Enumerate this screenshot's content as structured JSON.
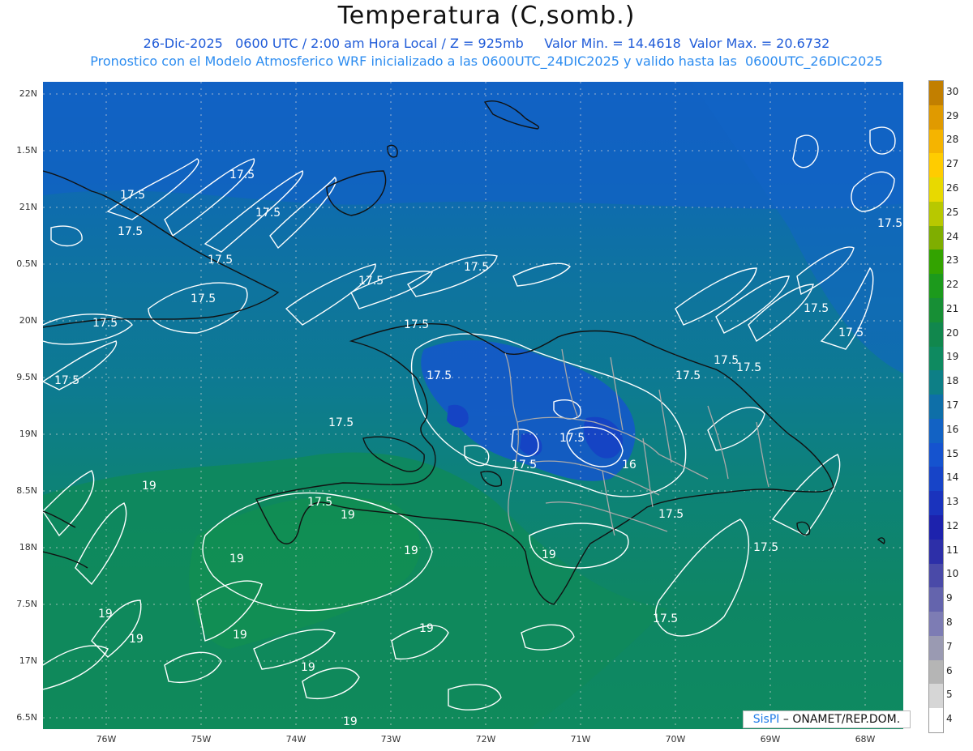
{
  "header": {
    "title": "Temperatura (C,somb.)",
    "line1": "26-Dic-2025   0600 UTC / 2:00 am Hora Local / Z = 925mb     Valor Min. = 14.4618  Valor Max. = 20.6732",
    "line2": "Pronostico con el Modelo Atmosferico WRF inicializado a las 0600UTC_24DIC2025 y valido hasta las  0600UTC_26DIC2025"
  },
  "axes": {
    "x_ticks": [
      "76W",
      "75W",
      "74W",
      "73W",
      "72W",
      "71W",
      "70W",
      "69W",
      "68W"
    ],
    "y_ticks": [
      "22N",
      "1.5N",
      "21N",
      "0.5N",
      "20N",
      "9.5N",
      "19N",
      "8.5N",
      "18N",
      "7.5N",
      "17N",
      "6.5N"
    ]
  },
  "legend": {
    "labels": [
      "30",
      "29",
      "28",
      "27",
      "26",
      "25",
      "24",
      "23",
      "22",
      "21",
      "20",
      "19",
      "18",
      "17",
      "16",
      "15",
      "14",
      "13",
      "12",
      "11",
      "10",
      "9",
      "8",
      "7",
      "6",
      "5",
      "4"
    ],
    "colors": [
      "#c27f00",
      "#e09a00",
      "#f5b400",
      "#ffcc00",
      "#e8d900",
      "#b8c800",
      "#7fae00",
      "#33a300",
      "#1c9a1c",
      "#178f35",
      "#11874d",
      "#0e8a60",
      "#0d7f86",
      "#0e6fa8",
      "#1262c4",
      "#1553cf",
      "#1744c8",
      "#1a33bd",
      "#1d22ad",
      "#2d2fa8",
      "#4a4aa8",
      "#6464ad",
      "#7d7cb4",
      "#9a9ab2",
      "#b5b5b5",
      "#d6d6d6",
      "#ffffff"
    ]
  },
  "contour_labels": [
    {
      "text": "17.5"
    },
    {
      "text": "17.5"
    },
    {
      "text": "17.5"
    },
    {
      "text": "17.5"
    },
    {
      "text": "17.5"
    },
    {
      "text": "17.5"
    },
    {
      "text": "17.5"
    },
    {
      "text": "17.5"
    },
    {
      "text": "17.5"
    },
    {
      "text": "17.5"
    },
    {
      "text": "17.5"
    },
    {
      "text": "17.5"
    },
    {
      "text": "17.5"
    },
    {
      "text": "17.5"
    },
    {
      "text": "17.5"
    },
    {
      "text": "17.5"
    },
    {
      "text": "17.5"
    },
    {
      "text": "16"
    },
    {
      "text": "17.5"
    },
    {
      "text": "17.5"
    },
    {
      "text": "17.5"
    },
    {
      "text": "17.5"
    },
    {
      "text": "17.5"
    },
    {
      "text": "19"
    },
    {
      "text": "19"
    },
    {
      "text": "19"
    },
    {
      "text": "19"
    },
    {
      "text": "19"
    },
    {
      "text": "19"
    },
    {
      "text": "19"
    },
    {
      "text": "19"
    },
    {
      "text": "19"
    },
    {
      "text": "19"
    },
    {
      "text": "19"
    },
    {
      "text": "17.5"
    },
    {
      "text": "17.5"
    },
    {
      "text": "17.5"
    }
  ],
  "watermark": {
    "brand": "SisPI",
    "org": " – ONAMET/REP.DOM."
  }
}
